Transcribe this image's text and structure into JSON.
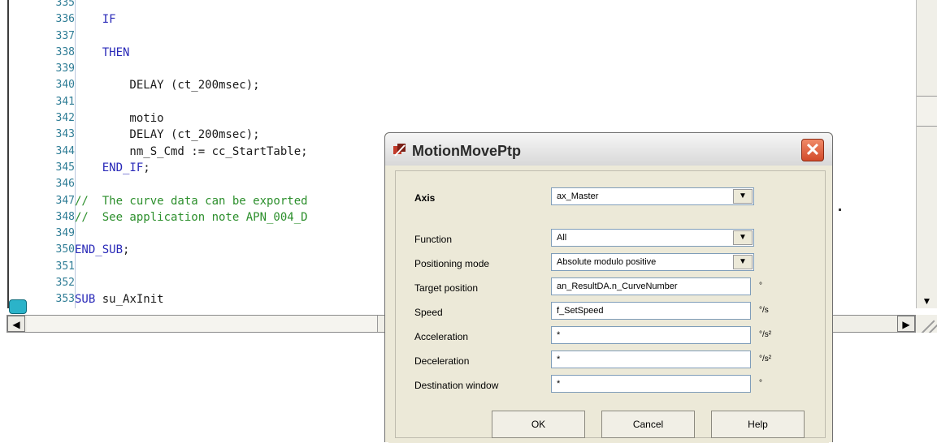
{
  "editor": {
    "lines": [
      {
        "num": "335",
        "segments": []
      },
      {
        "num": "336",
        "segments": [
          {
            "t": "    IF",
            "c": "kw"
          }
        ]
      },
      {
        "num": "337",
        "segments": []
      },
      {
        "num": "338",
        "segments": [
          {
            "t": "    THEN",
            "c": "kw"
          }
        ]
      },
      {
        "num": "339",
        "segments": []
      },
      {
        "num": "340",
        "segments": [
          {
            "t": "        DELAY (ct_200msec);",
            "c": "id"
          }
        ]
      },
      {
        "num": "341",
        "segments": []
      },
      {
        "num": "342",
        "segments": [
          {
            "t": "        motio",
            "c": "id"
          }
        ]
      },
      {
        "num": "343",
        "segments": [
          {
            "t": "        DELAY (ct_200msec);",
            "c": "id"
          }
        ]
      },
      {
        "num": "344",
        "segments": [
          {
            "t": "        nm_S_Cmd := cc_StartTable;",
            "c": "id"
          }
        ]
      },
      {
        "num": "345",
        "segments": [
          {
            "t": "    END_IF",
            "c": "kw"
          },
          {
            "t": ";",
            "c": "id"
          }
        ]
      },
      {
        "num": "346",
        "segments": []
      },
      {
        "num": "347",
        "segments": [
          {
            "t": "//  The curve data can be exported",
            "c": "cm"
          }
        ]
      },
      {
        "num": "348",
        "segments": [
          {
            "t": "//  See application note APN_004_D",
            "c": "cm"
          }
        ]
      },
      {
        "num": "349",
        "segments": []
      },
      {
        "num": "350",
        "segments": [
          {
            "t": "END_SUB",
            "c": "kw"
          },
          {
            "t": ";",
            "c": "id"
          }
        ]
      },
      {
        "num": "351",
        "segments": []
      },
      {
        "num": "352",
        "segments": []
      },
      {
        "num": "353",
        "segments": [
          {
            "t": "SUB",
            "c": "kw"
          },
          {
            "t": " su_AxInit",
            "c": "id"
          }
        ]
      }
    ]
  },
  "scroll": {
    "left_arrow": "◀",
    "right_arrow": "▶",
    "down_arrow": "▼"
  },
  "dialog": {
    "title": "MotionMovePtp",
    "close_glyph": "✕",
    "fields": {
      "axis": {
        "label": "Axis",
        "value": "ax_Master"
      },
      "function": {
        "label": "Function",
        "value": "All"
      },
      "positioning_mode": {
        "label": "Positioning mode",
        "value": "Absolute modulo positive"
      },
      "target_position": {
        "label": "Target position",
        "value": "an_ResultDA.n_CurveNumber",
        "unit": "°"
      },
      "speed": {
        "label": "Speed",
        "value": "f_SetSpeed",
        "unit": "°/s"
      },
      "acceleration": {
        "label": "Acceleration",
        "value": "*",
        "unit": "°/s²"
      },
      "deceleration": {
        "label": "Deceleration",
        "value": "*",
        "unit": "°/s²"
      },
      "destination_window": {
        "label": "Destination window",
        "value": "*",
        "unit": "°"
      }
    },
    "buttons": {
      "ok": "OK",
      "cancel": "Cancel",
      "help": "Help"
    }
  }
}
